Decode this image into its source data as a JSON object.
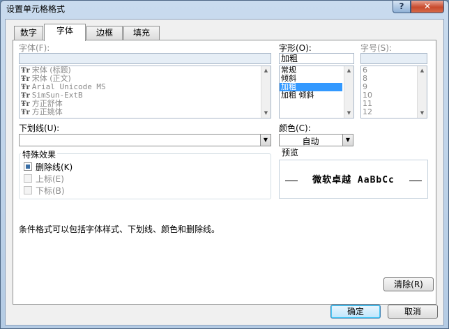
{
  "window": {
    "title": "设置单元格格式",
    "help_label": "?",
    "close_label": "✕"
  },
  "tabs": [
    {
      "label": "数字",
      "active": false
    },
    {
      "label": "字体",
      "active": true
    },
    {
      "label": "边框",
      "active": false
    },
    {
      "label": "填充",
      "active": false
    }
  ],
  "font": {
    "label": "字体(F):",
    "value": "",
    "icon": "truetype-icon",
    "items": [
      "宋体 (标题)",
      "宋体 (正文)",
      "Arial Unicode MS",
      "SimSun-ExtB",
      "方正舒体",
      "方正姚体"
    ]
  },
  "style": {
    "label": "字形(O):",
    "value": "加粗",
    "items": [
      "常规",
      "倾斜",
      "加粗",
      "加粗 倾斜"
    ],
    "selected_index": 2
  },
  "size": {
    "label": "字号(S):",
    "value": "",
    "items": [
      "6",
      "8",
      "9",
      "10",
      "11",
      "12"
    ]
  },
  "underline": {
    "label": "下划线(U):",
    "value": ""
  },
  "color": {
    "label": "颜色(C):",
    "value": "自动"
  },
  "effects": {
    "title": "特殊效果",
    "strikethrough": {
      "label": "删除线(K)",
      "checked": true
    },
    "superscript": {
      "label": "上标(E)",
      "checked": false,
      "disabled": true
    },
    "subscript": {
      "label": "下标(B)",
      "checked": false,
      "disabled": true
    }
  },
  "preview": {
    "title": "预览",
    "sample": "微软卓越  AaBbCc"
  },
  "info_text": "条件格式可以包括字体样式、下划线、颜色和删除线。",
  "buttons": {
    "clear": "清除(R)",
    "ok": "确定",
    "cancel": "取消"
  },
  "colors": {
    "selection": "#3399ff",
    "titlebar": "#c9dbee",
    "close": "#c84a2d"
  }
}
